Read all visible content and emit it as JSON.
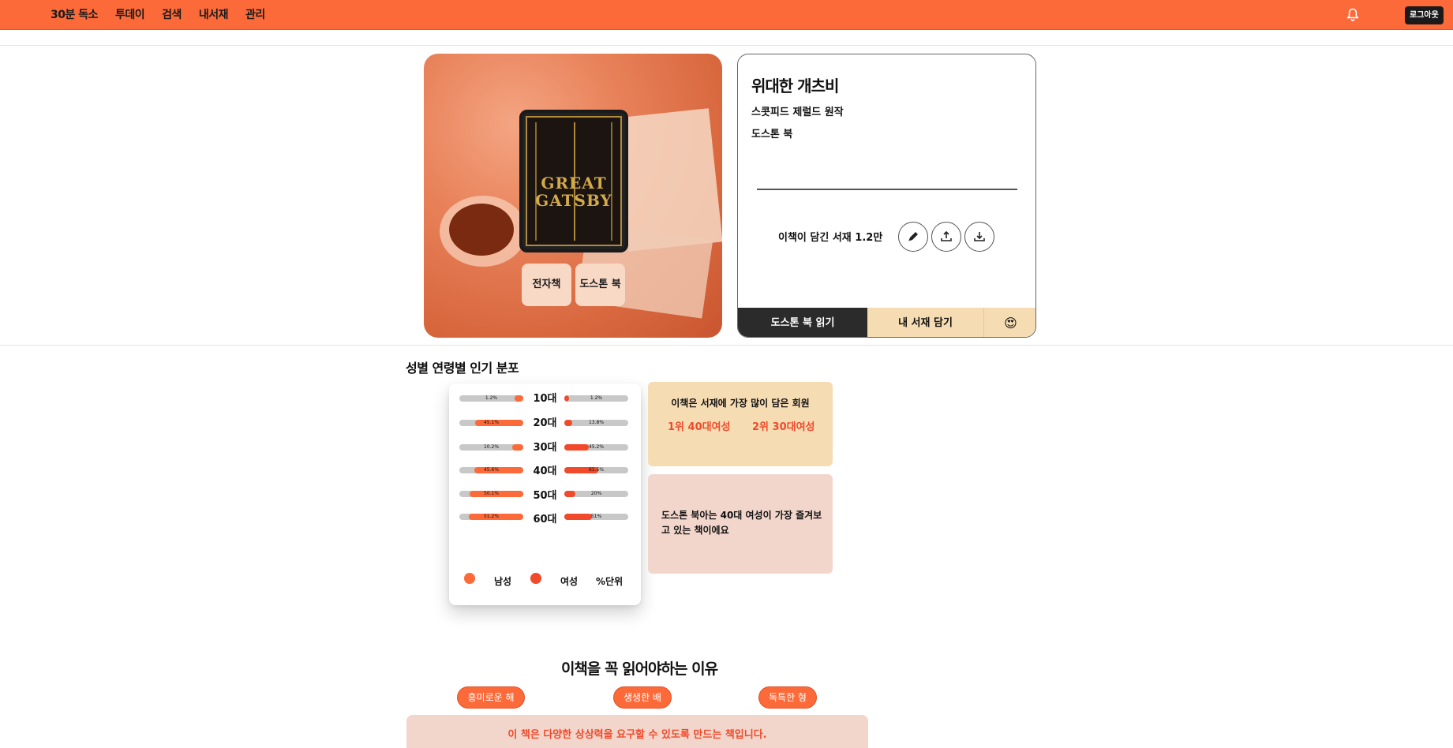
{
  "nav": {
    "items": [
      "30분 독소",
      "투데이",
      "검색",
      "내서재",
      "관리"
    ],
    "logout_label": "로그아웃"
  },
  "book": {
    "title": "위대한 개츠비",
    "subtitle": "스콧피드 제럴드 원작",
    "publisher": "도스톤 북",
    "cover_text": "GREAT GATSBY",
    "chips": [
      "전자책",
      "도스톤 북"
    ],
    "shelf_count_text": "이책이 담긴 서재 1.2만",
    "actions": {
      "read_label": "도스톤 북 읽기",
      "shelf_label": "내 서재 담기",
      "emoji": "😍"
    }
  },
  "distribution": {
    "section_title": "성별 연령별 인기 분포",
    "rows": [
      {
        "age": "10대",
        "male_text": "1.2%",
        "male": 1.2,
        "female_text": "1.2%",
        "female": 1.2
      },
      {
        "age": "20대",
        "male_text": "45.1%",
        "male": 45.1,
        "female_text": "13.8%",
        "female": 13.8
      },
      {
        "age": "30대",
        "male_text": "10.2%",
        "male": 10.2,
        "female_text": "45.2%",
        "female": 45.2
      },
      {
        "age": "40대",
        "male_text": "45.6%",
        "male": 45.6,
        "female_text": "61.5%",
        "female": 61.5
      },
      {
        "age": "50대",
        "male_text": "50.1%",
        "male": 50.1,
        "female_text": "20%",
        "female": 20
      },
      {
        "age": "60대",
        "male_text": "51.2%",
        "male": 51.2,
        "female_text": "51%",
        "female": 51
      }
    ],
    "legend": {
      "male": "남성",
      "female": "여성",
      "unit": "%단위"
    },
    "colors": {
      "male": "#fd6a3a",
      "female": "#f04a2a",
      "track": "#c8c8c8"
    }
  },
  "top_readers": {
    "title": "이책은 서재에 가장 많이 담은 회원",
    "rank1": "1위 40대여성",
    "rank2": "2위 30대여성"
  },
  "note": "도스톤 북아는 40대 여성이 가장 즐겨보고 있는 책이에요",
  "reasons": {
    "title": "이책을 꼭 읽어야하는 이유",
    "tags": [
      "흥미로운 해설",
      "생생한 배경",
      "독특한 형식"
    ],
    "text": "이 책은 다양한 상상력을 요구할 수 있도록 만드는 책입니다."
  }
}
